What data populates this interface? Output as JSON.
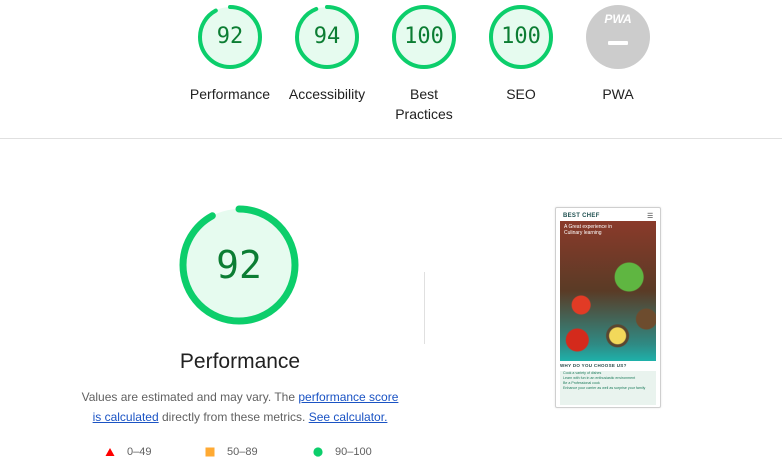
{
  "categories": [
    {
      "label": "Performance",
      "score": "92",
      "value": 92,
      "color": "#0cce6b"
    },
    {
      "label": "Accessibility",
      "score": "94",
      "value": 94,
      "color": "#0cce6b"
    },
    {
      "label": "Best Practices",
      "label_line1": "Best",
      "label_line2": "Practices",
      "score": "100",
      "value": 100,
      "color": "#0cce6b"
    },
    {
      "label": "SEO",
      "score": "100",
      "value": 100,
      "color": "#0cce6b"
    },
    {
      "label": "PWA",
      "badge": "PWA",
      "color": "#cccccc"
    }
  ],
  "main": {
    "score": "92",
    "value": 92,
    "title": "Performance",
    "desc_prefix": "Values are estimated and may vary. The ",
    "link_score": "performance score is calculated",
    "desc_middle": " directly from these metrics. ",
    "link_calc": "See calculator."
  },
  "legend": [
    {
      "range": "0–49",
      "shape": "triangle",
      "color": "#ff0000"
    },
    {
      "range": "50–89",
      "shape": "square",
      "color": "#ffaa33"
    },
    {
      "range": "90–100",
      "shape": "circle",
      "color": "#0cce6b"
    }
  ],
  "screenshot": {
    "brand": "BEST CHEF",
    "menu_icon": "hamburger-icon",
    "hero_text": "A Great experience in Culinary learning",
    "section_title": "WHY DO YOU CHOOSE US?",
    "list": [
      "Cook a variety of dishes",
      "Learn with fun in an enthusiastic environment",
      "Be a Professional cook",
      "Enhance your carrier as well as surprise your family"
    ]
  },
  "colors": {
    "pass": "#0cce6b",
    "pass_text": "#0c7d33",
    "pass_bg": "#e6fbef",
    "link": "#1a53c4"
  }
}
